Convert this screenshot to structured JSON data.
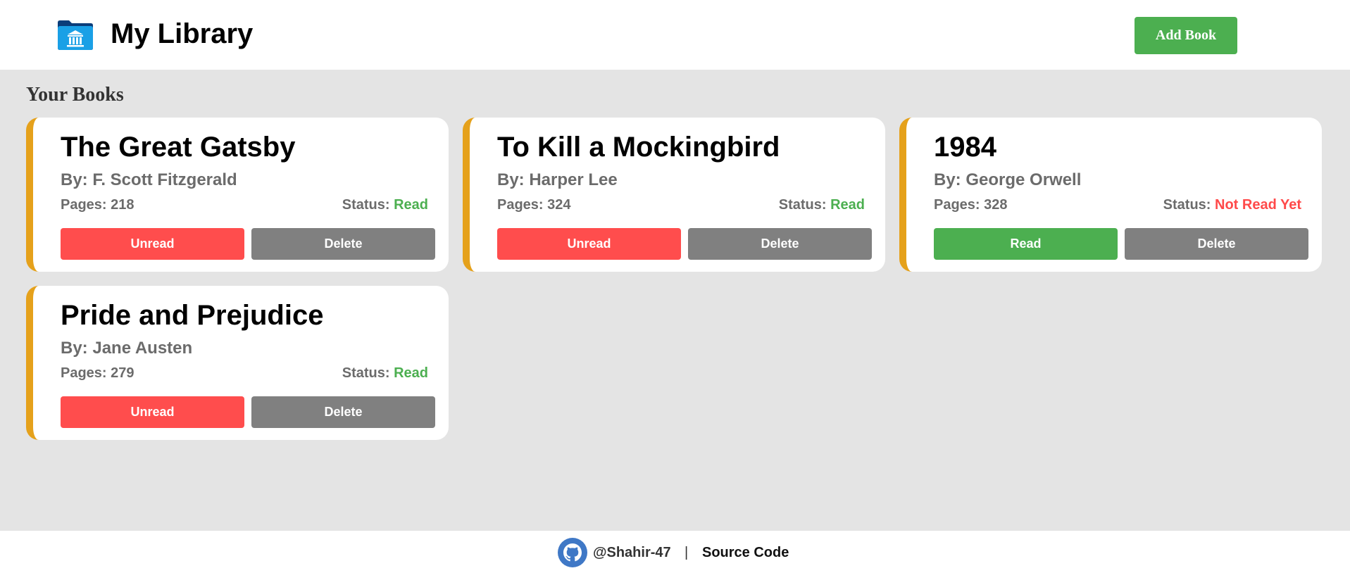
{
  "header": {
    "title": "My Library",
    "add_button_label": "Add Book"
  },
  "section_title": "Your Books",
  "books": [
    {
      "title": "The Great Gatsby",
      "author": "By: F. Scott Fitzgerald",
      "pages": "Pages: 218",
      "status_label": "Status: ",
      "status_value": "Read",
      "toggle_label": "Unread",
      "delete_label": "Delete"
    },
    {
      "title": "To Kill a Mockingbird",
      "author": "By: Harper Lee",
      "pages": "Pages: 324",
      "status_label": "Status: ",
      "status_value": "Read",
      "toggle_label": "Unread",
      "delete_label": "Delete"
    },
    {
      "title": "1984",
      "author": "By: George Orwell",
      "pages": "Pages: 328",
      "status_label": "Status: ",
      "status_value": "Not Read Yet",
      "toggle_label": "Read",
      "delete_label": "Delete"
    },
    {
      "title": "Pride and Prejudice",
      "author": "By: Jane Austen",
      "pages": "Pages: 279",
      "status_label": "Status: ",
      "status_value": "Read",
      "toggle_label": "Unread",
      "delete_label": "Delete"
    }
  ],
  "footer": {
    "handle": "@Shahir-47",
    "separator": "|",
    "source_label": "Source Code"
  },
  "colors": {
    "accent_green": "#4caf50",
    "accent_red": "#ff4d4d",
    "delete_gray": "#808080",
    "card_border": "#e5a11b"
  },
  "icons": {
    "logo": "library-folder-icon",
    "footer": "github-icon"
  }
}
